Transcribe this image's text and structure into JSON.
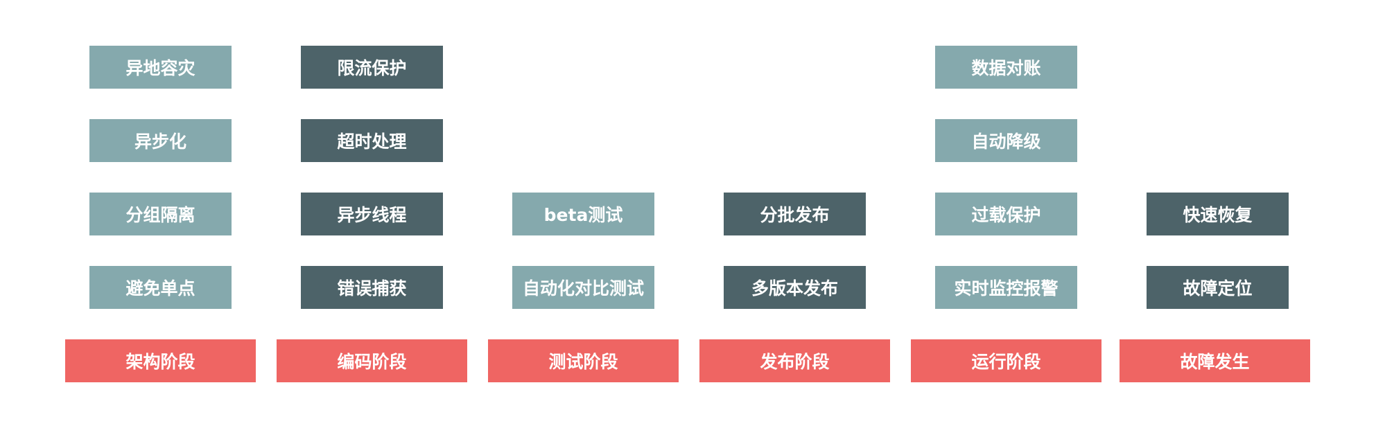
{
  "colors": {
    "light_box": "#85a9ad",
    "dark_box": "#4d6369",
    "stage": "#ef6563",
    "text": "#ffffff"
  },
  "columns": [
    {
      "stage": "架构阶段",
      "items": [
        "异地容灾",
        "异步化",
        "分组隔离",
        "避免单点"
      ]
    },
    {
      "stage": "编码阶段",
      "items": [
        "限流保护",
        "超时处理",
        "异步线程",
        "错误捕获"
      ]
    },
    {
      "stage": "测试阶段",
      "items": [
        "beta测试",
        "自动化对比测试"
      ]
    },
    {
      "stage": "发布阶段",
      "items": [
        "分批发布",
        "多版本发布"
      ]
    },
    {
      "stage": "运行阶段",
      "items": [
        "数据对账",
        "自动降级",
        "过载保护",
        "实时监控报警"
      ]
    },
    {
      "stage": "故障发生",
      "items": [
        "快速恢复",
        "故障定位"
      ]
    }
  ]
}
